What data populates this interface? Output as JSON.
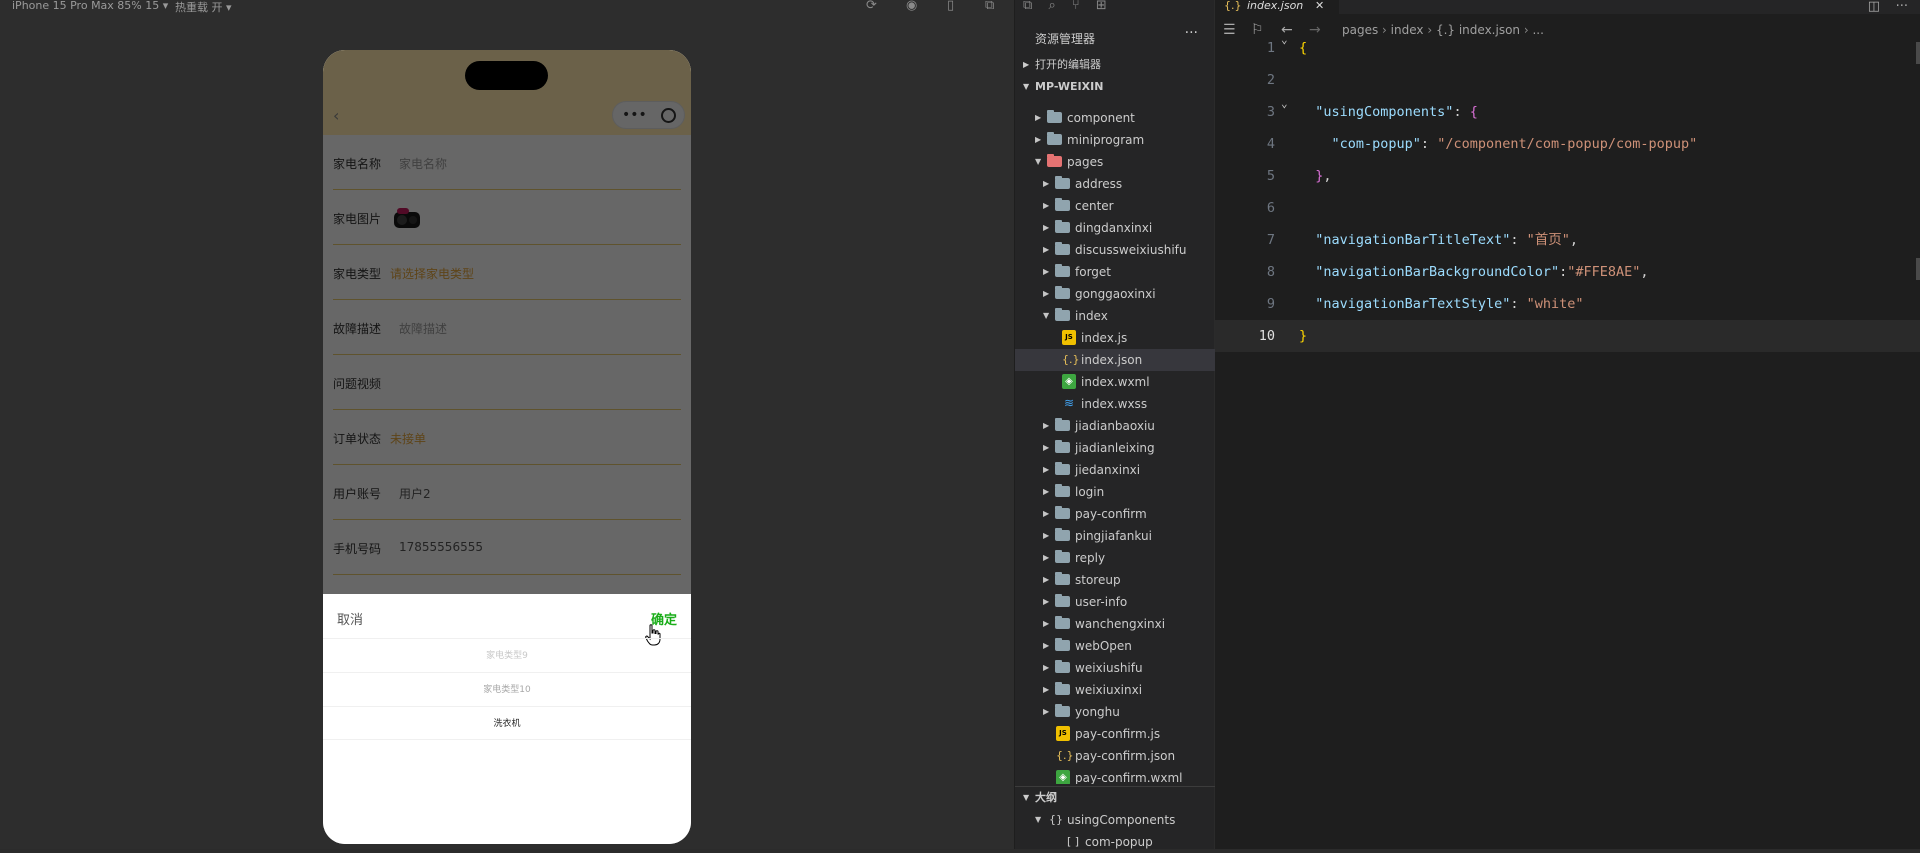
{
  "simulator": {
    "device": "iPhone 15 Pro Max 85% 15 ▾",
    "hot_reload": "热重载 开 ▾",
    "form": {
      "rows": [
        {
          "label": "家电名称",
          "value": "家电名称",
          "style": "placeholder"
        },
        {
          "label": "家电图片",
          "value": "",
          "style": "image"
        },
        {
          "label": "家电类型",
          "value": "请选择家电类型",
          "style": "orange"
        },
        {
          "label": "故障描述",
          "value": "故障描述",
          "style": "placeholder"
        },
        {
          "label": "问题视频",
          "value": "",
          "style": "empty"
        },
        {
          "label": "订单状态",
          "value": "未接单",
          "style": "orange"
        },
        {
          "label": "用户账号",
          "value": "用户2",
          "style": "normal"
        },
        {
          "label": "手机号码",
          "value": "17855556555",
          "style": "normal"
        }
      ]
    },
    "picker": {
      "cancel": "取消",
      "confirm": "确定",
      "options": [
        {
          "label": "家电类型9",
          "state": "faded"
        },
        {
          "label": "家电类型10",
          "state": "near"
        },
        {
          "label": "洗衣机",
          "state": "selected"
        }
      ]
    }
  },
  "explorer": {
    "title": "资源管理器",
    "more": "···",
    "open_editors": "打开的编辑器",
    "root": "MP-WEIXIN",
    "tree": [
      {
        "name": "component",
        "kind": "folder",
        "depth": 0,
        "expanded": false
      },
      {
        "name": "miniprogram",
        "kind": "folder",
        "depth": 0,
        "expanded": false
      },
      {
        "name": "pages",
        "kind": "folder-red",
        "depth": 0,
        "expanded": true
      },
      {
        "name": "address",
        "kind": "folder",
        "depth": 1,
        "expanded": false
      },
      {
        "name": "center",
        "kind": "folder",
        "depth": 1,
        "expanded": false
      },
      {
        "name": "dingdanxinxi",
        "kind": "folder",
        "depth": 1,
        "expanded": false
      },
      {
        "name": "discussweixiushifu",
        "kind": "folder",
        "depth": 1,
        "expanded": false
      },
      {
        "name": "forget",
        "kind": "folder",
        "depth": 1,
        "expanded": false
      },
      {
        "name": "gonggaoxinxi",
        "kind": "folder",
        "depth": 1,
        "expanded": false
      },
      {
        "name": "index",
        "kind": "folder",
        "depth": 1,
        "expanded": true
      },
      {
        "name": "index.js",
        "kind": "js",
        "depth": 2
      },
      {
        "name": "index.json",
        "kind": "json",
        "depth": 2,
        "selected": true
      },
      {
        "name": "index.wxml",
        "kind": "wxml",
        "depth": 2
      },
      {
        "name": "index.wxss",
        "kind": "wxss",
        "depth": 2
      },
      {
        "name": "jiadianbaoxiu",
        "kind": "folder",
        "depth": 1,
        "expanded": false
      },
      {
        "name": "jiadianleixing",
        "kind": "folder",
        "depth": 1,
        "expanded": false
      },
      {
        "name": "jiedanxinxi",
        "kind": "folder",
        "depth": 1,
        "expanded": false
      },
      {
        "name": "login",
        "kind": "folder",
        "depth": 1,
        "expanded": false
      },
      {
        "name": "pay-confirm",
        "kind": "folder",
        "depth": 1,
        "expanded": false
      },
      {
        "name": "pingjiafankui",
        "kind": "folder",
        "depth": 1,
        "expanded": false
      },
      {
        "name": "reply",
        "kind": "folder",
        "depth": 1,
        "expanded": false
      },
      {
        "name": "storeup",
        "kind": "folder",
        "depth": 1,
        "expanded": false
      },
      {
        "name": "user-info",
        "kind": "folder",
        "depth": 1,
        "expanded": false
      },
      {
        "name": "wanchengxinxi",
        "kind": "folder",
        "depth": 1,
        "expanded": false
      },
      {
        "name": "webOpen",
        "kind": "folder",
        "depth": 1,
        "expanded": false
      },
      {
        "name": "weixiushifu",
        "kind": "folder",
        "depth": 1,
        "expanded": false
      },
      {
        "name": "weixiuxinxi",
        "kind": "folder",
        "depth": 1,
        "expanded": false
      },
      {
        "name": "yonghu",
        "kind": "folder",
        "depth": 1,
        "expanded": false
      },
      {
        "name": "pay-confirm.js",
        "kind": "js",
        "depth": 1
      },
      {
        "name": "pay-confirm.json",
        "kind": "json",
        "depth": 1
      },
      {
        "name": "pay-confirm.wxml",
        "kind": "wxml",
        "depth": 1
      }
    ],
    "outline_title": "大纲",
    "outline_items": [
      {
        "name": "usingComponents",
        "icon": "{}",
        "expanded": true
      },
      {
        "name": "com-popup",
        "icon": "[ ]",
        "expanded": false
      }
    ]
  },
  "editor": {
    "tab": "index.json",
    "breadcrumb": [
      "pages",
      "index",
      "{.} index.json",
      "..."
    ],
    "lines": [
      {
        "n": "1",
        "text": "{"
      },
      {
        "n": "2",
        "text": ""
      },
      {
        "n": "3",
        "text": "  \"usingComponents\": {"
      },
      {
        "n": "4",
        "text": "    \"com-popup\": \"/component/com-popup/com-popup\""
      },
      {
        "n": "5",
        "text": "  },"
      },
      {
        "n": "6",
        "text": ""
      },
      {
        "n": "7",
        "text": "  \"navigationBarTitleText\": \"首页\","
      },
      {
        "n": "8",
        "text": "  \"navigationBarBackgroundColor\":\"#FFE8AE\","
      },
      {
        "n": "9",
        "text": "  \"navigationBarTextStyle\": \"white\""
      },
      {
        "n": "10",
        "text": "}"
      }
    ],
    "current_line": "10"
  },
  "colors": {
    "nav_bg": "#ffe8ae",
    "confirm_green": "#1aad19",
    "accent_orange": "#e0a23a",
    "string": "#ce9178",
    "key": "#9cdcfe"
  }
}
